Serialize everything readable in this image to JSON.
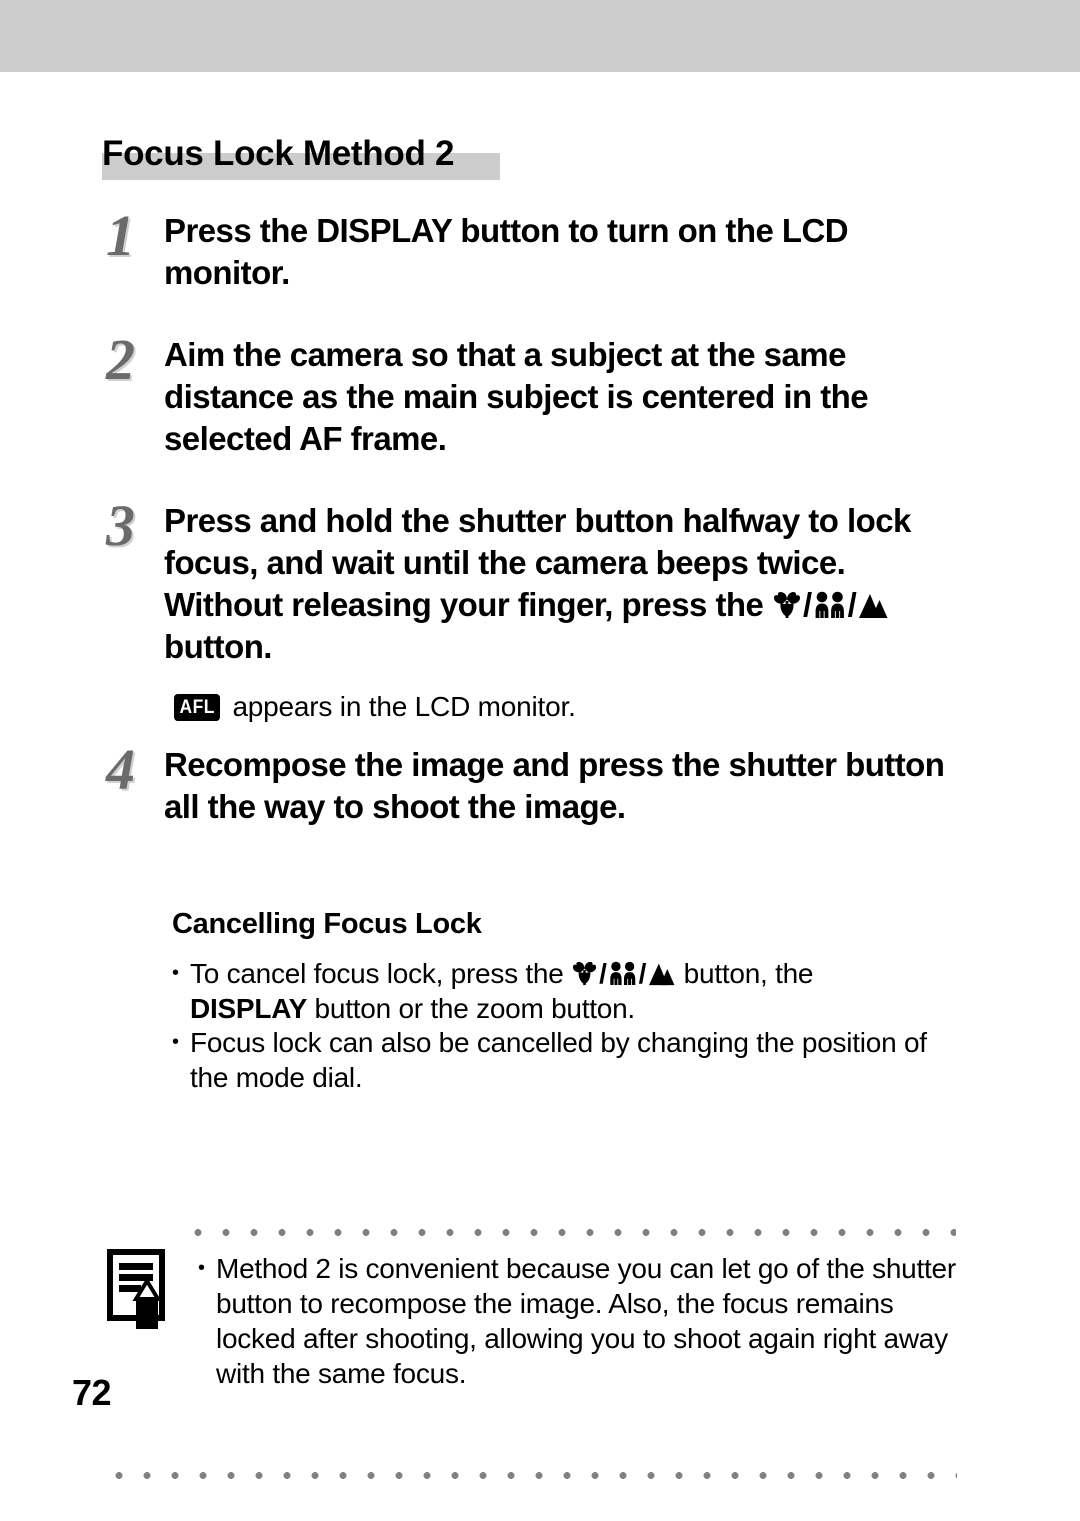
{
  "document": {
    "page_number": "72",
    "section_title": "Focus Lock Method 2"
  },
  "steps": [
    {
      "number": "1",
      "text": "Press the DISPLAY button to turn on the LCD monitor."
    },
    {
      "number": "2",
      "text": "Aim the camera so that a subject at the same distance as the main subject is centered in the selected AF frame."
    },
    {
      "number": "3",
      "text_before_icons": "Press and hold the shutter button halfway to lock focus, and wait until the camera beeps twice. Without releasing your finger, press the ",
      "text_after_icons": " button."
    },
    {
      "number": "4",
      "text": "Recompose the image and press the shutter button all the way to shoot the image."
    }
  ],
  "afl_note": {
    "badge_label": "AFL",
    "text": "appears in the LCD monitor."
  },
  "cancelling": {
    "heading": "Cancelling Focus Lock",
    "bullet_1": {
      "text_before_icons": "To cancel focus lock, press the ",
      "text_after_icons": " button, the ",
      "bold_word": "DISPLAY",
      "text_tail": " button or the zoom button."
    },
    "bullet_2": {
      "text": "Focus lock can also be cancelled by changing the position of the mode dial."
    }
  },
  "note_box": {
    "icon_name": "memo-note-icon",
    "bullet_text": "Method 2 is convenient because you can let go of the shutter button to recompose the image. Also, the focus remains locked after shooting, allowing you to shoot again right away with the same focus."
  },
  "icons": {
    "macro_flower": "macro-flower-icon",
    "two_people": "portrait-two-people-icon",
    "mountain": "landscape-mountain-icon",
    "separator": "/"
  },
  "colors": {
    "band_gray": "#cccccc",
    "title_highlight_gray": "#cccccc",
    "step_number_gray": "#6b6b6b",
    "dot_rule_gray": "#808080",
    "text_black": "#000000",
    "page_background": "#ffffff"
  }
}
